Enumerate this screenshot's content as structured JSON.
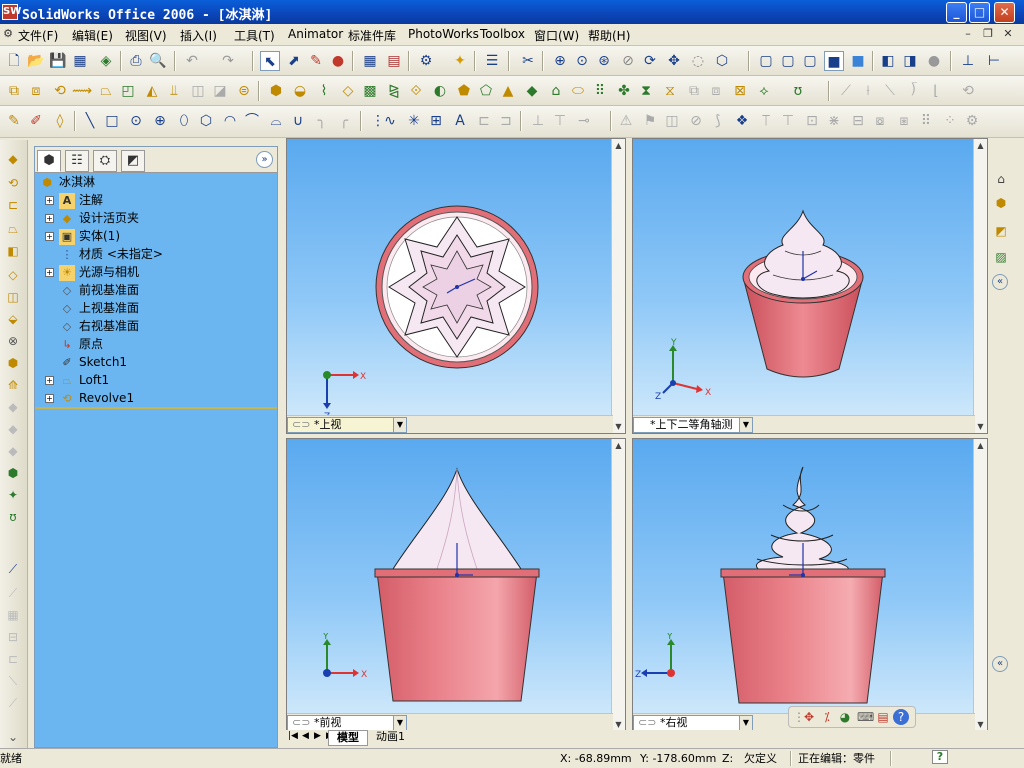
{
  "window": {
    "title": "SolidWorks Office 2006 - [冰淇淋]",
    "app_icon": "SW"
  },
  "menu": [
    {
      "label": "文件(F)"
    },
    {
      "label": "编辑(E)"
    },
    {
      "label": "视图(V)"
    },
    {
      "label": "插入(I)"
    },
    {
      "label": "工具(T)"
    },
    {
      "label": "Animator"
    },
    {
      "label": "标准件库"
    },
    {
      "label": "PhotoWorks"
    },
    {
      "label": "Toolbox"
    },
    {
      "label": "窗口(W)"
    },
    {
      "label": "帮助(H)"
    }
  ],
  "feature_manager": {
    "root": "冰淇淋",
    "items": [
      {
        "label": "注解",
        "icon": "annotation-icon",
        "expandable": true
      },
      {
        "label": "设计活页夹",
        "icon": "binder-icon",
        "expandable": true
      },
      {
        "label": "实体(1)",
        "icon": "solid-body-icon",
        "expandable": true
      },
      {
        "label": "材质 <未指定>",
        "icon": "material-icon",
        "expandable": false
      },
      {
        "label": "光源与相机",
        "icon": "lights-camera-icon",
        "expandable": true
      },
      {
        "label": "前视基准面",
        "icon": "plane-icon",
        "expandable": false
      },
      {
        "label": "上视基准面",
        "icon": "plane-icon",
        "expandable": false
      },
      {
        "label": "右视基准面",
        "icon": "plane-icon",
        "expandable": false
      },
      {
        "label": "原点",
        "icon": "origin-icon",
        "expandable": false
      },
      {
        "label": "Sketch1",
        "icon": "sketch-icon",
        "expandable": false
      },
      {
        "label": "Loft1",
        "icon": "loft-icon",
        "expandable": true
      },
      {
        "label": "Revolve1",
        "icon": "revolve-icon",
        "expandable": true
      }
    ]
  },
  "viewports": [
    {
      "label": "*上视",
      "axes": [
        "X",
        "Z"
      ]
    },
    {
      "label": "*上下二等角轴测",
      "axes": [
        "Y",
        "X",
        "Z"
      ]
    },
    {
      "label": "*前视",
      "axes": [
        "Y",
        "X"
      ]
    },
    {
      "label": "*右视",
      "axes": [
        "Y",
        "Z"
      ]
    }
  ],
  "tabs": {
    "model": "模型",
    "animation": "动画1"
  },
  "status": {
    "ready": "就绪",
    "x": "X: -68.89mm",
    "y": "Y: -178.60mm",
    "z": "Z:",
    "defined": "欠定义",
    "editing": "正在编辑：零件"
  },
  "colors": {
    "viewport_top": "#5aa9ef",
    "cup": "#e26f78",
    "cream": "#f6e8f2",
    "title_bar": "#0b45b8",
    "tree_bg": "#6bb6f0"
  }
}
